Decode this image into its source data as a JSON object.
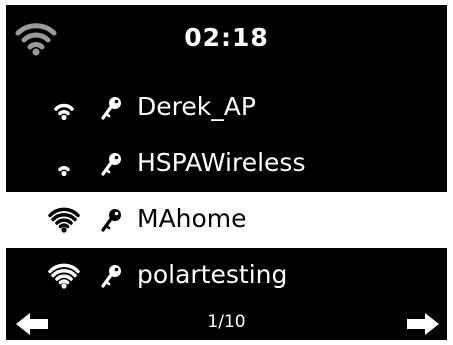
{
  "header": {
    "time": "02:18",
    "status_icon": "wifi-status-icon"
  },
  "networks": [
    {
      "ssid": "Derek_AP",
      "signal_bars": 3,
      "secured": true,
      "selected": false
    },
    {
      "ssid": "HSPAWireless",
      "signal_bars": 2,
      "secured": true,
      "selected": false
    },
    {
      "ssid": "MAhome",
      "signal_bars": 4,
      "secured": true,
      "selected": true
    },
    {
      "ssid": "polartesting",
      "signal_bars": 4,
      "secured": true,
      "selected": false
    }
  ],
  "footer": {
    "page_indicator": "1/10",
    "prev_icon": "arrow-left-icon",
    "next_icon": "arrow-right-icon"
  },
  "colors": {
    "background": "#000000",
    "text": "#ffffff",
    "selected_row": "#ffffff",
    "selected_text": "#000000",
    "status_icon": "#9a9a9a"
  }
}
